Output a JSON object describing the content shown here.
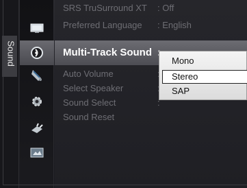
{
  "side_label": "Sound",
  "menu": {
    "items": [
      {
        "label": "SRS TruSurround XT",
        "value": ": Off"
      },
      {
        "label": "Preferred Language",
        "value": ": English"
      },
      {
        "label": "Multi-Track Sound",
        "value": ":"
      },
      {
        "label": "Auto Volume",
        "value": ":"
      },
      {
        "label": "Select Speaker",
        "value": ":"
      },
      {
        "label": "Sound Select",
        "value": ":"
      },
      {
        "label": "Sound Reset",
        "value": ""
      }
    ]
  },
  "dropdown": {
    "options": [
      "Mono",
      "Stereo",
      "SAP"
    ],
    "selected": "Stereo"
  },
  "icons": [
    "picture-icon",
    "sound-icon",
    "channel-icon",
    "setup-icon",
    "input-icon",
    "application-icon"
  ],
  "colors": {
    "highlight_bar": "#5c5c62",
    "inactive_text": "#6e6e74",
    "active_text": "#ffffff",
    "dropdown_bg": "#ececec"
  }
}
